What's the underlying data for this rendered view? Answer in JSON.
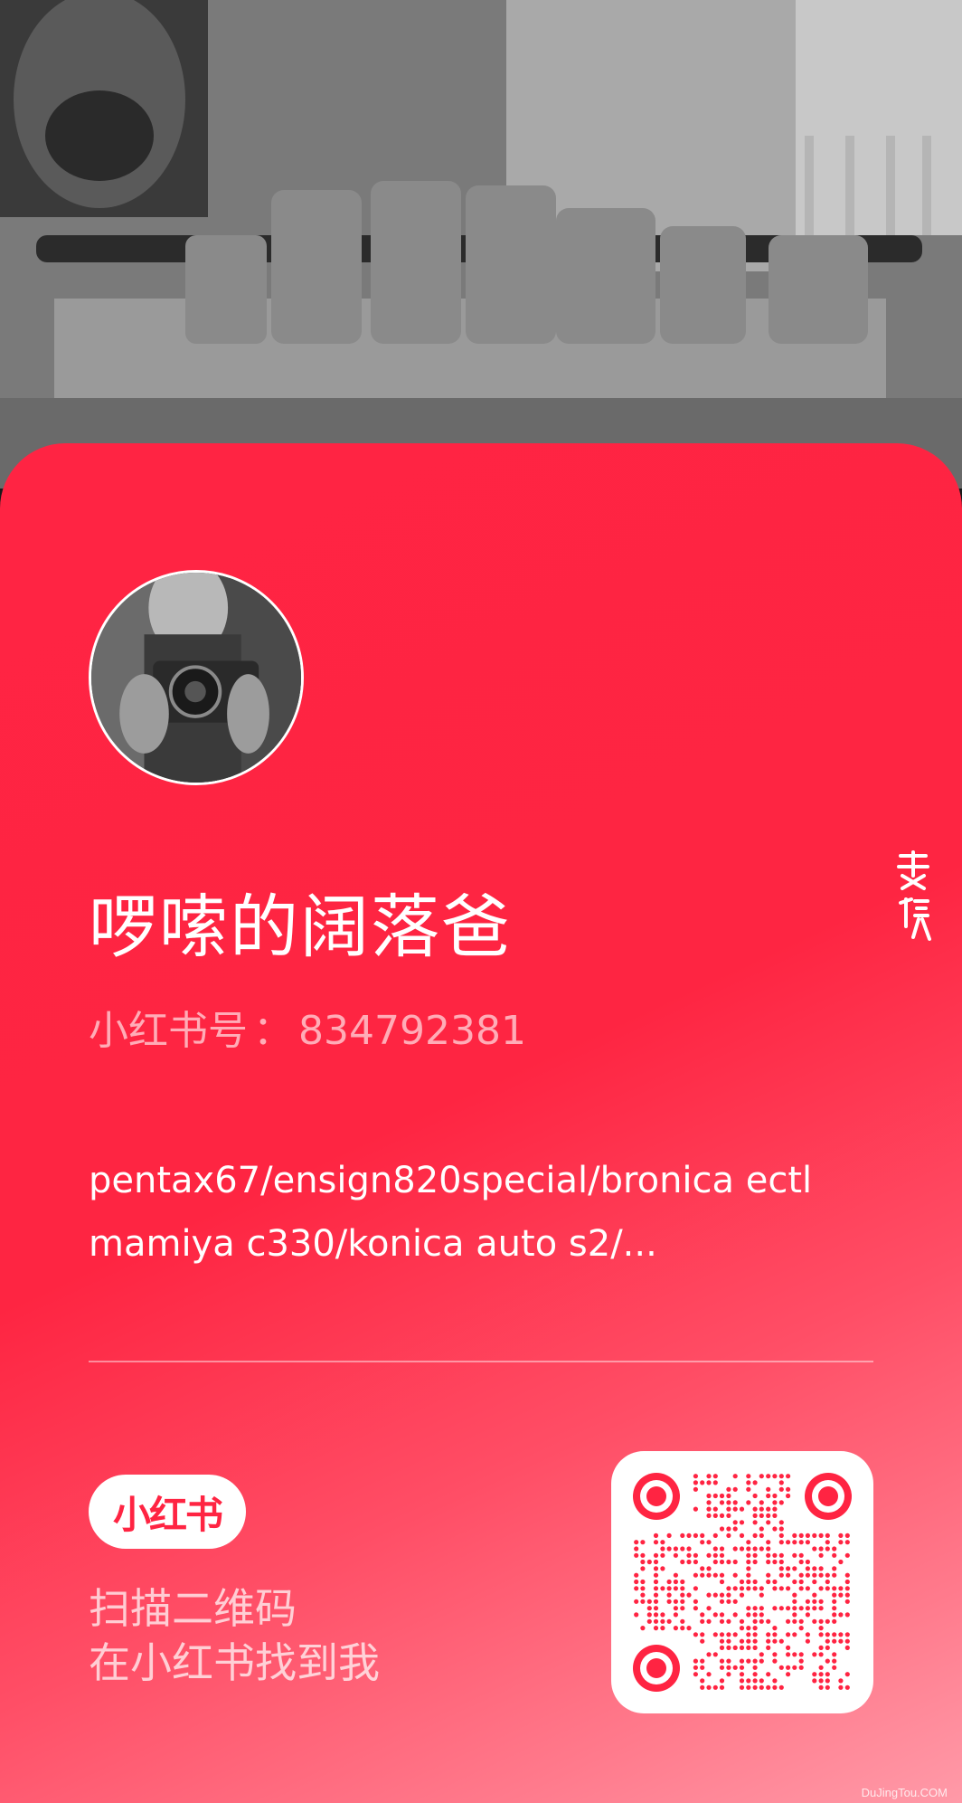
{
  "profile": {
    "nickname": "啰嗦的阔落爸",
    "id_label": "小红书号",
    "id_separator": "：",
    "id_value": "834792381",
    "bio_lines": [
      "pentax67/ensign820special/bronica ectl",
      "mamiya c330/konica auto s2/..."
    ]
  },
  "brand": {
    "logo_text": "小红书"
  },
  "qr_hint": {
    "line1": "扫描二维码",
    "line2": "在小红书找到我"
  },
  "watermark": "DuJingTou.COM",
  "icons": {
    "seal": "signature-seal-icon",
    "qr": "qr-code-icon",
    "avatar": "avatar-photo"
  },
  "colors": {
    "brand_red": "#ff2442",
    "card_gradient_start": "#ff2443",
    "card_gradient_end": "#ff9aa8"
  }
}
